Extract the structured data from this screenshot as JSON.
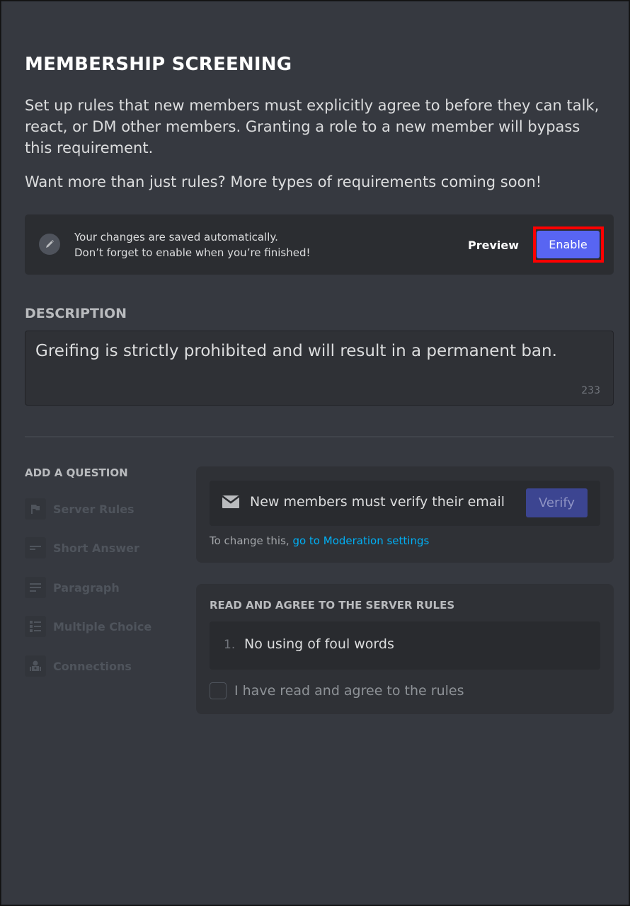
{
  "page": {
    "title": "MEMBERSHIP SCREENING",
    "intro": "Set up rules that new members must explicitly agree to before they can talk, react, or DM other members. Granting a role to a new member will bypass this requirement.",
    "intro_more": "Want more than just rules? More types of requirements coming soon!"
  },
  "notice": {
    "icon": "pencil-icon",
    "line1": "Your changes are saved automatically.",
    "line2": "Don’t forget to enable when you’re finished!",
    "preview_label": "Preview",
    "enable_label": "Enable",
    "enable_color": "#5865f2",
    "highlight_color": "#ff0000"
  },
  "description": {
    "label": "DESCRIPTION",
    "value": "Greifing is strictly prohibited and will result in a permanent ban.",
    "char_count": "233"
  },
  "add_question": {
    "label": "ADD A QUESTION",
    "types": [
      {
        "label": "Server Rules",
        "icon": "flag-icon"
      },
      {
        "label": "Short Answer",
        "icon": "short-answer-icon"
      },
      {
        "label": "Paragraph",
        "icon": "paragraph-icon"
      },
      {
        "label": "Multiple Choice",
        "icon": "list-icon"
      },
      {
        "label": "Connections",
        "icon": "robot-icon"
      }
    ]
  },
  "email_card": {
    "icon": "envelope-icon",
    "text": "New members must verify their email",
    "verify_label": "Verify",
    "change_prefix": "To change this,",
    "change_link": "go to Moderation settings",
    "link_color": "#00aff4"
  },
  "rules_card": {
    "label": "READ AND AGREE TO THE SERVER RULES",
    "rules": [
      {
        "num": "1.",
        "text": "No using of foul words"
      }
    ],
    "agree_label": "I have read and agree to the rules",
    "agree_checked": false
  }
}
